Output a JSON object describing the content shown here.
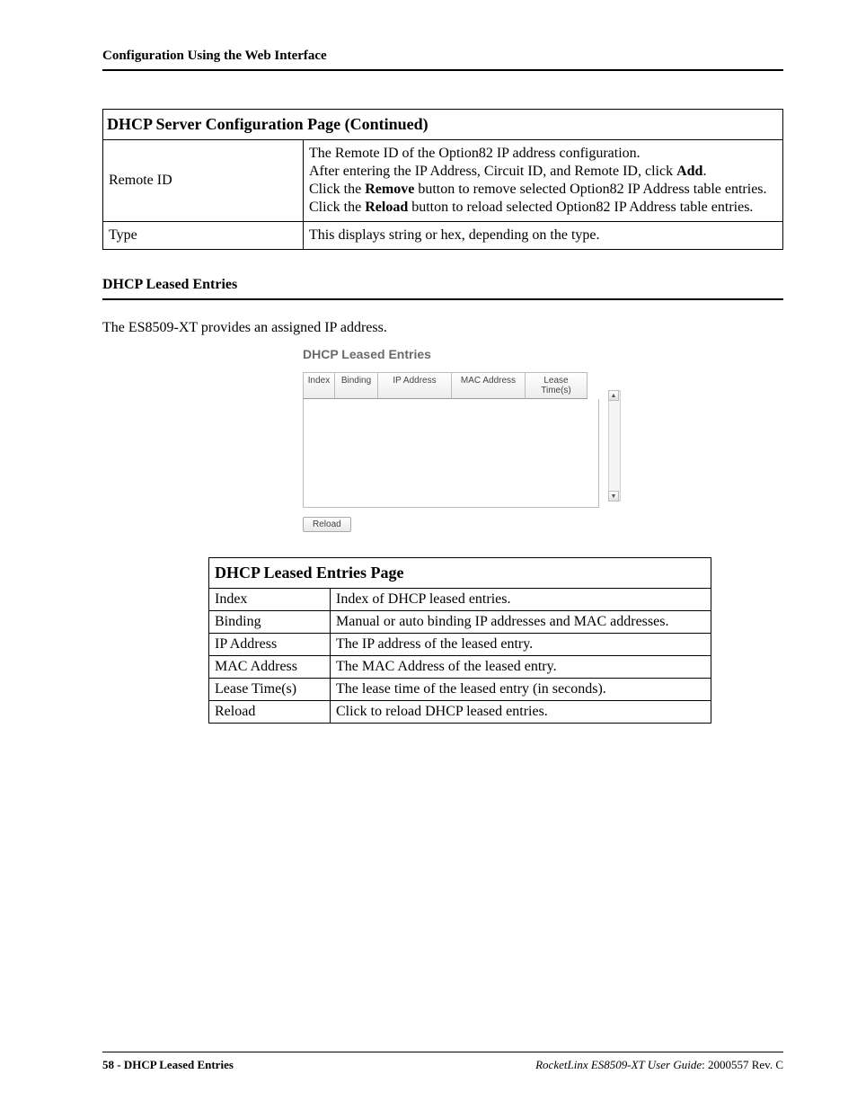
{
  "header": {
    "running": "Configuration Using the Web Interface"
  },
  "config_table": {
    "title": "DHCP Server Configuration Page  (Continued)",
    "rows": [
      {
        "label": "Remote ID",
        "lines": [
          {
            "pre": "The Remote ID of the Option82 IP address configuration."
          },
          {
            "pre": "After entering the IP Address, Circuit ID, and Remote ID, click ",
            "bold": "Add",
            "post": "."
          },
          {
            "pre": "Click the ",
            "bold": "Remove",
            "post": " button to remove selected Option82 IP Address table entries."
          },
          {
            "pre": "Click the ",
            "bold": "Reload",
            "post": " button to reload selected Option82 IP Address table entries."
          }
        ]
      },
      {
        "label": "Type",
        "lines": [
          {
            "pre": "This displays string or hex, depending on the type."
          }
        ]
      }
    ]
  },
  "section": {
    "heading": "DHCP Leased Entries",
    "intro": "The ES8509-XT provides an assigned IP address."
  },
  "shot": {
    "title": "DHCP Leased Entries",
    "cols": {
      "index": "Index",
      "binding": "Binding",
      "ip": "IP Address",
      "mac": "MAC Address",
      "lease": "Lease Time(s)"
    },
    "reload": "Reload"
  },
  "def_table": {
    "title": "DHCP Leased Entries Page",
    "rows": [
      {
        "k": "Index",
        "v": "Index of DHCP leased entries."
      },
      {
        "k": "Binding",
        "v": "Manual or auto binding IP addresses and MAC addresses."
      },
      {
        "k": "IP Address",
        "v": "The IP address of the leased entry."
      },
      {
        "k": "MAC Address",
        "v": "The MAC Address of the leased entry."
      },
      {
        "k": "Lease Time(s)",
        "v": "The lease time of the leased entry (in seconds)."
      },
      {
        "k": "Reload",
        "v": "Click to reload DHCP leased entries."
      }
    ]
  },
  "footer": {
    "page": "58",
    "section": "DHCP Leased Entries",
    "product": "RocketLinx ES8509-XT User Guide",
    "doc": "2000557 Rev. C"
  }
}
